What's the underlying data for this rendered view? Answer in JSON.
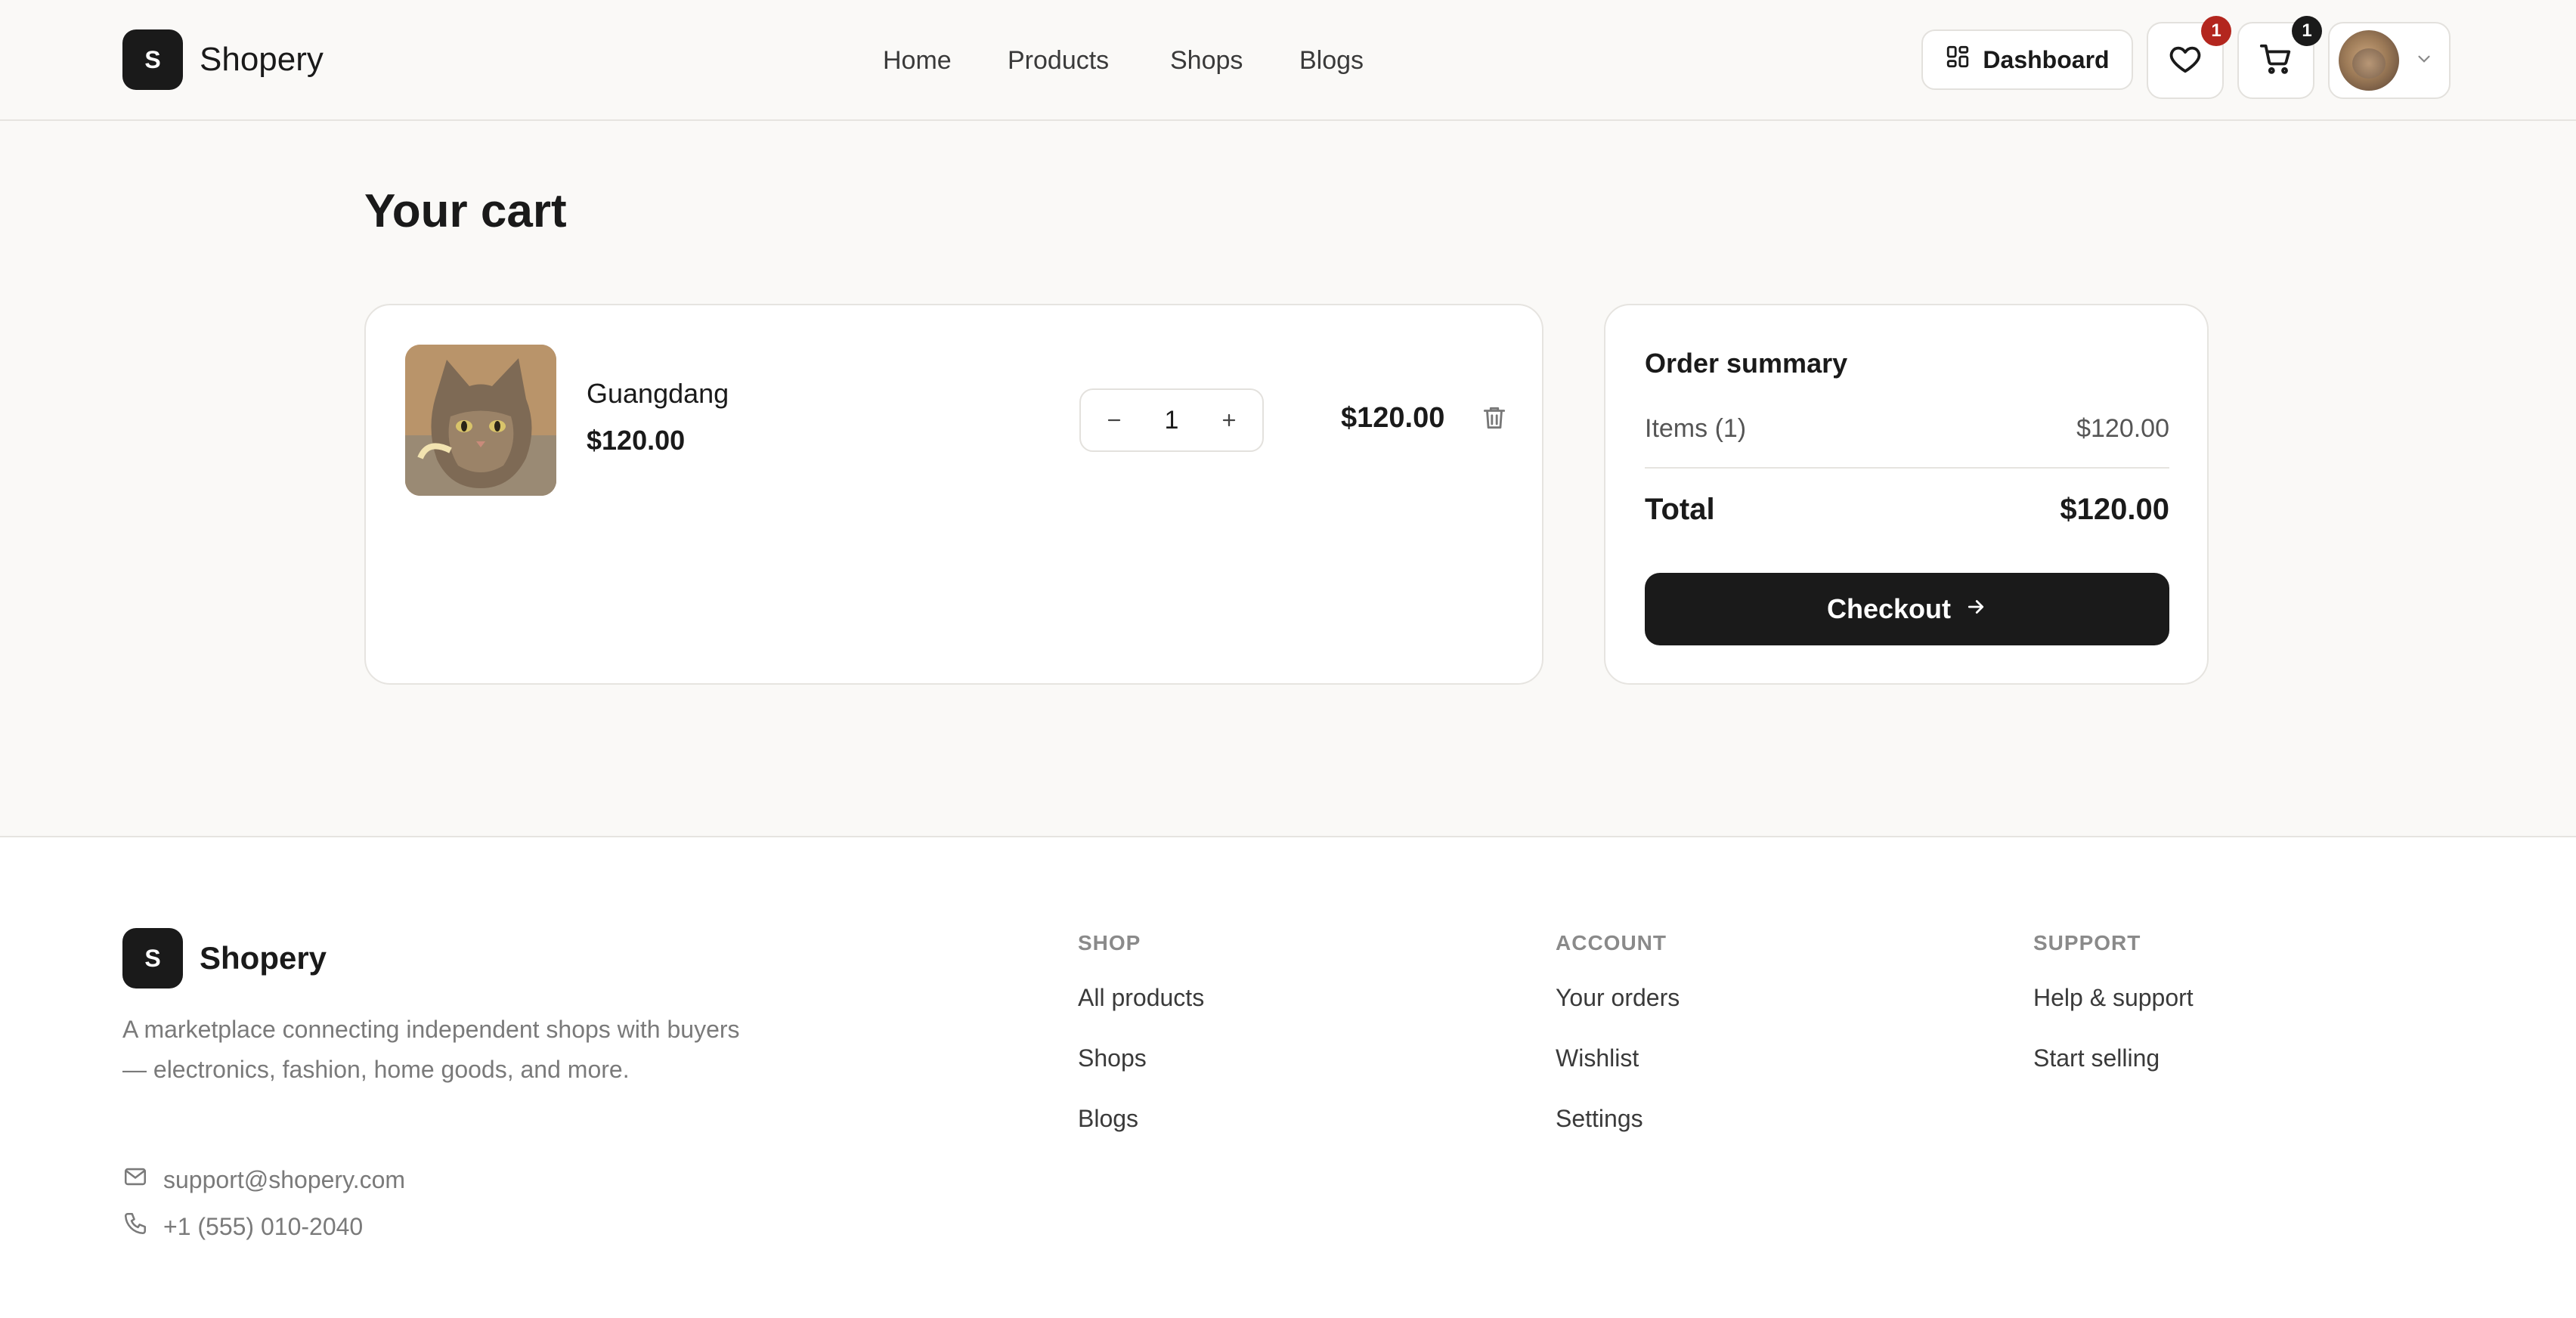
{
  "brand": {
    "logo_letter": "S",
    "name": "Shopery"
  },
  "nav": {
    "items": [
      "Home",
      "Products",
      "Shops",
      "Blogs"
    ]
  },
  "header": {
    "dashboard_label": "Dashboard",
    "wishlist_count": "1",
    "cart_count": "1",
    "wishlist_badge_color": "#b3261e",
    "cart_badge_color": "#1a1a1a"
  },
  "cart": {
    "title": "Your cart",
    "items": [
      {
        "name": "Guangdang",
        "price": "$120.00",
        "quantity": "1",
        "line_total": "$120.00"
      }
    ]
  },
  "summary": {
    "title": "Order summary",
    "items_label": "Items (1)",
    "items_value": "$120.00",
    "total_label": "Total",
    "total_value": "$120.00",
    "checkout_label": "Checkout"
  },
  "footer": {
    "logo_letter": "S",
    "name": "Shopery",
    "description": "A marketplace connecting independent shops with buyers — electronics, fashion, home goods, and more.",
    "email": "support@shopery.com",
    "phone": "+1 (555) 010-2040",
    "columns": [
      {
        "heading": "SHOP",
        "links": [
          "All products",
          "Shops",
          "Blogs"
        ]
      },
      {
        "heading": "ACCOUNT",
        "links": [
          "Your orders",
          "Wishlist",
          "Settings"
        ]
      },
      {
        "heading": "SUPPORT",
        "links": [
          "Help & support",
          "Start selling"
        ]
      }
    ]
  },
  "colors": {
    "accent": "#1a1a1a",
    "background": "#faf9f7",
    "border": "#e6e4e0"
  }
}
